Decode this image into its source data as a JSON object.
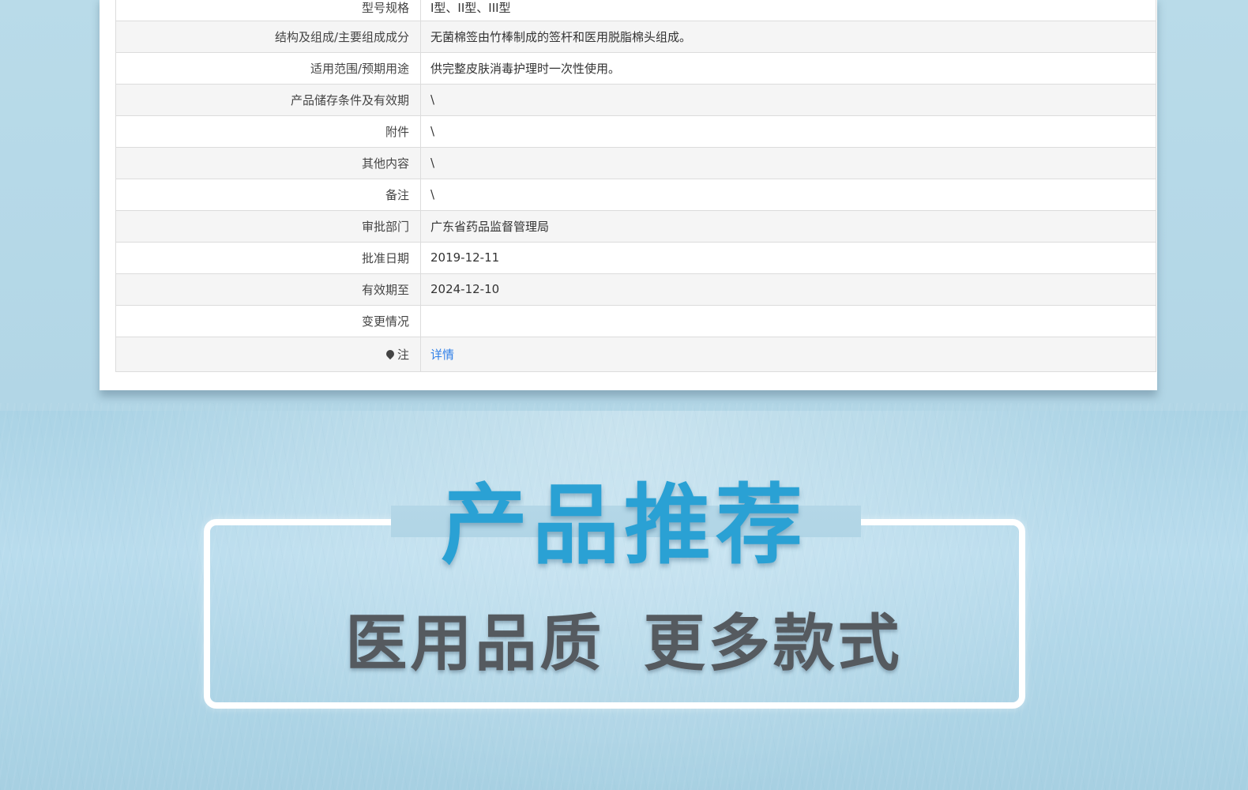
{
  "registration_table": {
    "rows": [
      {
        "label": "型号规格",
        "value": "I型、II型、III型"
      },
      {
        "label": "结构及组成/主要组成成分",
        "value": "无菌棉签由竹棒制成的签杆和医用脱脂棉头组成。"
      },
      {
        "label": "适用范围/预期用途",
        "value": "供完整皮肤消毒护理时一次性使用。"
      },
      {
        "label": "产品储存条件及有效期",
        "value": "\\"
      },
      {
        "label": "附件",
        "value": "\\"
      },
      {
        "label": "其他内容",
        "value": "\\"
      },
      {
        "label": "备注",
        "value": "\\"
      },
      {
        "label": "审批部门",
        "value": "广东省药品监督管理局"
      },
      {
        "label": "批准日期",
        "value": "2019-12-11"
      },
      {
        "label": "有效期至",
        "value": "2024-12-10"
      },
      {
        "label": "变更情况",
        "value": ""
      },
      {
        "label": "注",
        "value": "详情",
        "icon": "map-pin-icon"
      }
    ]
  },
  "promo": {
    "title": "产品推荐",
    "subtitle": "医用品质 更多款式"
  },
  "colors": {
    "title": "#2aa1d4",
    "subtitle": "#555a5f",
    "link": "#2f7fe8",
    "background": "#b3d7e7"
  }
}
